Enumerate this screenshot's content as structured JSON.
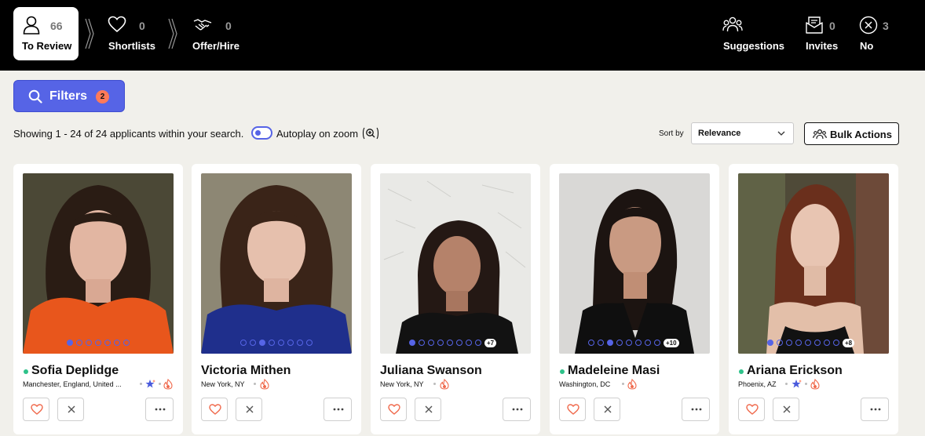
{
  "stages": {
    "to_review": {
      "count": "66",
      "label": "To Review",
      "icon": "person-icon"
    },
    "shortlists": {
      "count": "0",
      "label": "Shortlists",
      "icon": "heart-icon"
    },
    "offer_hire": {
      "count": "0",
      "label": "Offer/Hire",
      "icon": "handshake-icon"
    },
    "suggestions": {
      "label": "Suggestions",
      "icon": "people-icon"
    },
    "invites": {
      "count": "0",
      "label": "Invites",
      "icon": "invite-icon"
    },
    "no": {
      "count": "3",
      "label": "No",
      "icon": "x-circle-icon"
    }
  },
  "filters": {
    "label": "Filters",
    "badge": "2"
  },
  "results": {
    "showing": "Showing 1 - 24 of 24 applicants within your search.",
    "autoplay_label": "Autoplay on zoom",
    "autoplay_on": true
  },
  "sort": {
    "label": "Sort by",
    "value": "Relevance"
  },
  "bulk_actions": {
    "label": "Bulk Actions"
  },
  "colors": {
    "accent": "#5664e6",
    "badge": "#ff7a59",
    "online": "#2ec28a",
    "heart": "#f06b4e"
  },
  "applicants": [
    {
      "name": "Sofia Deplidge",
      "location": "Manchester, England, United ...",
      "online": true,
      "featured": true,
      "hot": true,
      "photos": 7,
      "active_photo": 1,
      "extra_photos": ""
    },
    {
      "name": "Victoria Mithen",
      "location": "New York, NY",
      "online": false,
      "featured": false,
      "hot": true,
      "photos": 8,
      "active_photo": 3,
      "extra_photos": ""
    },
    {
      "name": "Juliana Swanson",
      "location": "New York, NY",
      "online": false,
      "featured": false,
      "hot": true,
      "photos": 8,
      "active_photo": 1,
      "extra_photos": "+7"
    },
    {
      "name": "Madeleine Masi",
      "location": "Washington, DC",
      "online": true,
      "featured": false,
      "hot": true,
      "photos": 8,
      "active_photo": 3,
      "extra_photos": "+10"
    },
    {
      "name": "Ariana Erickson",
      "location": "Phoenix, AZ",
      "online": true,
      "featured": true,
      "hot": true,
      "photos": 8,
      "active_photo": 1,
      "extra_photos": "+8"
    }
  ]
}
